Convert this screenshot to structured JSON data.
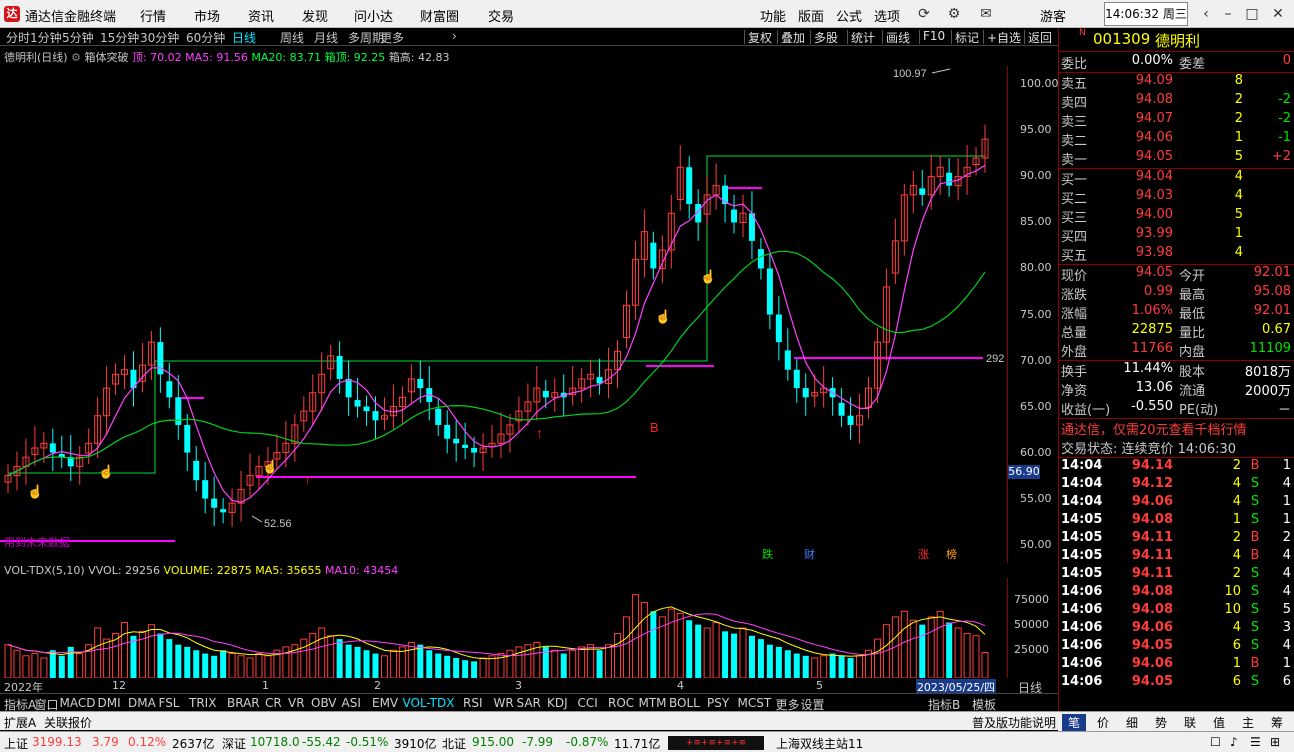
{
  "app": {
    "title": "通达信金融终端",
    "logo_char": "达"
  },
  "menu": [
    "行情",
    "市场",
    "资讯",
    "发现",
    "问小达",
    "财富圈",
    "交易"
  ],
  "topright": {
    "items": [
      "功能",
      "版面",
      "公式",
      "选项"
    ],
    "guest": "游客",
    "clock": "14:06:32 周三"
  },
  "periods": [
    "分时",
    "1分钟",
    "5分钟",
    "15分钟",
    "30分钟",
    "60分钟",
    "日线",
    "周线",
    "月线",
    "多周期",
    "更多"
  ],
  "active_period": "日线",
  "tools": [
    "复权",
    "叠加",
    "多股",
    "统计",
    "画线",
    "F10",
    "标记",
    "+自选",
    "返回"
  ],
  "chart_info": {
    "name": "德明利(日线)",
    "indicator": "箱体突破",
    "top": "顶: 70.02",
    "ma5": "MA5: 91.56",
    "ma20": "MA20: 83.71",
    "boxtop": "箱顶: 92.25",
    "boxheight": "箱高: 42.83"
  },
  "chart_labels": {
    "high_label": "100.97",
    "low_label": "52.56",
    "current_box": "292",
    "current_price_tag": "56.90",
    "future_note": "用到未来数据",
    "buy_marker": "B",
    "events": [
      "跌",
      "财",
      "涨",
      "榜"
    ]
  },
  "y_axis": [
    "100.00",
    "95.00",
    "90.00",
    "85.00",
    "80.00",
    "75.00",
    "70.00",
    "65.00",
    "60.00",
    "55.00",
    "50.00"
  ],
  "vol_info": {
    "name": "VOL-TDX(5,10)",
    "vvol": "VVOL: 29256",
    "volume": "VOLUME: 22875",
    "ma5": "MA5: 35655",
    "ma10": "MA10: 43454"
  },
  "vol_axis": [
    "75000",
    "50000",
    "25000"
  ],
  "dates": [
    "2022年",
    "12",
    "1",
    "2",
    "3",
    "4",
    "5"
  ],
  "date_tag": "2023/05/25/四",
  "date_mode": "日线",
  "indicators": [
    "指标A",
    "窗口",
    "MACD",
    "DMI",
    "DMA",
    "FSL",
    "TRIX",
    "BRAR",
    "CR",
    "VR",
    "OBV",
    "ASI",
    "EMV",
    "VOL-TDX",
    "RSI",
    "WR",
    "SAR",
    "KDJ",
    "CCI",
    "ROC",
    "MTM",
    "BOLL",
    "PSY",
    "MCST",
    "更多",
    "设置"
  ],
  "ind_right": [
    "指标B",
    "模板"
  ],
  "expand": [
    "扩展A",
    "关联报价"
  ],
  "expand_right": "普及版功能说明",
  "stock": {
    "code": "001309",
    "name": "德明利",
    "flag": "N"
  },
  "weibi": {
    "label": "委比",
    "value": "0.00%",
    "label2": "委差",
    "value2": "0"
  },
  "asks": [
    {
      "label": "卖五",
      "price": "94.09",
      "vol": "8",
      "chg": ""
    },
    {
      "label": "卖四",
      "price": "94.08",
      "vol": "2",
      "chg": "-2"
    },
    {
      "label": "卖三",
      "price": "94.07",
      "vol": "2",
      "chg": "-2"
    },
    {
      "label": "卖二",
      "price": "94.06",
      "vol": "1",
      "chg": "-1"
    },
    {
      "label": "卖一",
      "price": "94.05",
      "vol": "5",
      "chg": "+2"
    }
  ],
  "bids": [
    {
      "label": "买一",
      "price": "94.04",
      "vol": "4",
      "chg": ""
    },
    {
      "label": "买二",
      "price": "94.03",
      "vol": "4",
      "chg": ""
    },
    {
      "label": "买三",
      "price": "94.00",
      "vol": "5",
      "chg": ""
    },
    {
      "label": "买四",
      "price": "93.99",
      "vol": "1",
      "chg": ""
    },
    {
      "label": "买五",
      "price": "93.98",
      "vol": "4",
      "chg": ""
    }
  ],
  "quote": [
    {
      "l1": "现价",
      "v1": "94.05",
      "l2": "今开",
      "v2": "92.01",
      "c1": "red",
      "c2": "red"
    },
    {
      "l1": "涨跌",
      "v1": "0.99",
      "l2": "最高",
      "v2": "95.08",
      "c1": "red",
      "c2": "red"
    },
    {
      "l1": "涨幅",
      "v1": "1.06%",
      "l2": "最低",
      "v2": "92.01",
      "c1": "red",
      "c2": "red"
    },
    {
      "l1": "总量",
      "v1": "22875",
      "l2": "量比",
      "v2": "0.67",
      "c1": "yel",
      "c2": "yel"
    },
    {
      "l1": "外盘",
      "v1": "11766",
      "l2": "内盘",
      "v2": "11109",
      "c1": "red",
      "c2": "grn"
    }
  ],
  "finance": [
    {
      "l1": "换手",
      "v1": "11.44%",
      "l2": "股本",
      "v2": "8018万"
    },
    {
      "l1": "净资",
      "v1": "13.06",
      "l2": "流通",
      "v2": "2000万"
    },
    {
      "l1": "收益(一)",
      "v1": "-0.550",
      "l2": "PE(动)",
      "v2": "－"
    }
  ],
  "promo": "通达信，仅需20元查看千档行情",
  "trade_status": "交易状态: 连续竞价 14:06:30",
  "ticks": [
    [
      "14:04",
      "94.14",
      "2",
      "B",
      "1"
    ],
    [
      "14:04",
      "94.12",
      "4",
      "S",
      "4"
    ],
    [
      "14:04",
      "94.06",
      "4",
      "S",
      "1"
    ],
    [
      "14:05",
      "94.08",
      "1",
      "S",
      "1"
    ],
    [
      "14:05",
      "94.11",
      "2",
      "B",
      "2"
    ],
    [
      "14:05",
      "94.11",
      "4",
      "B",
      "4"
    ],
    [
      "14:05",
      "94.11",
      "2",
      "S",
      "4"
    ],
    [
      "14:06",
      "94.08",
      "10",
      "S",
      "4"
    ],
    [
      "14:06",
      "94.08",
      "10",
      "S",
      "5"
    ],
    [
      "14:06",
      "94.06",
      "4",
      "S",
      "3"
    ],
    [
      "14:06",
      "94.05",
      "6",
      "S",
      "4"
    ],
    [
      "14:06",
      "94.06",
      "1",
      "B",
      "1"
    ],
    [
      "14:06",
      "94.05",
      "6",
      "S",
      "6"
    ]
  ],
  "rtabs": [
    "笔",
    "价",
    "细",
    "势",
    "联",
    "值",
    "主",
    "筹"
  ],
  "status": {
    "sh_label": "上证",
    "sh": "3199.13",
    "sh_chg": "3.79",
    "sh_pct": "0.12%",
    "sh_amt": "2637亿",
    "sz_label": "深证",
    "sz": "10718.0",
    "sz_chg": "-55.42",
    "sz_pct": "-0.51%",
    "sz_amt": "3910亿",
    "bz_label": "北证",
    "bz": "915.00",
    "bz_chg": "-7.99",
    "bz_pct": "-0.87%",
    "bz_amt": "11.71亿",
    "station": "上海双线主站11"
  },
  "chart_data": {
    "type": "candlestick",
    "y_range": [
      48,
      102
    ],
    "closes": [
      57.5,
      58.5,
      59.5,
      60.5,
      61,
      60,
      59.5,
      58.5,
      59.5,
      61,
      64,
      67,
      68.5,
      69,
      67,
      69.5,
      72,
      68.5,
      66,
      63,
      60,
      57,
      55,
      54,
      53.5,
      54.5,
      56,
      57.5,
      58.5,
      59,
      60,
      61,
      63,
      64.5,
      66.5,
      68.5,
      70.5,
      68,
      66,
      65,
      64.5,
      63.5,
      64,
      65,
      66,
      68,
      67,
      65.5,
      63,
      61.5,
      61,
      60.5,
      60,
      60.5,
      61,
      62,
      63,
      64.5,
      65.5,
      67,
      66,
      66.5,
      66,
      67,
      68,
      68.5,
      67.5,
      69,
      71,
      76,
      81,
      84,
      80,
      82,
      86,
      91,
      87,
      85,
      88,
      89,
      87,
      85,
      86,
      83,
      80,
      75,
      72,
      69,
      67,
      66,
      66.5,
      67,
      66,
      64,
      63,
      64,
      67,
      72,
      78,
      83,
      88,
      89,
      88,
      90,
      91,
      89,
      90,
      91,
      92,
      94.05
    ],
    "volume": [
      30,
      25,
      20,
      22,
      18,
      25,
      20,
      28,
      22,
      30,
      45,
      35,
      40,
      50,
      38,
      42,
      48,
      40,
      35,
      30,
      28,
      25,
      22,
      20,
      25,
      22,
      20,
      18,
      22,
      20,
      25,
      28,
      30,
      35,
      40,
      45,
      38,
      35,
      30,
      28,
      25,
      22,
      20,
      25,
      28,
      32,
      30,
      25,
      22,
      20,
      18,
      16,
      15,
      18,
      20,
      22,
      25,
      28,
      30,
      32,
      28,
      25,
      22,
      25,
      28,
      30,
      25,
      30,
      40,
      55,
      75,
      68,
      60,
      55,
      62,
      58,
      52,
      48,
      45,
      50,
      42,
      40,
      45,
      38,
      35,
      30,
      28,
      25,
      22,
      20,
      18,
      20,
      22,
      20,
      18,
      20,
      25,
      35,
      48,
      55,
      60,
      52,
      48,
      55,
      60,
      50,
      45,
      40,
      38,
      22.875
    ],
    "events": [
      "跌",
      "财",
      "涨",
      "榜"
    ]
  }
}
